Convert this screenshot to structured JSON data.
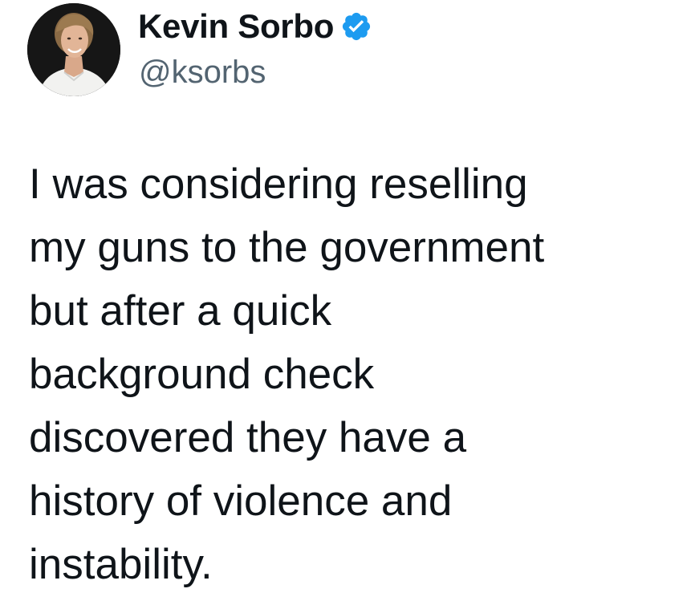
{
  "author": {
    "name": "Kevin Sorbo",
    "handle": "@ksorbs",
    "verified_icon": "verified-badge-icon",
    "verified_color": "#1d9bf0"
  },
  "tweet": {
    "lines": [
      "I was considering reselling",
      "my guns to the government",
      "but after a quick",
      "background check",
      "discovered they have a",
      "history of violence and",
      "instability."
    ]
  },
  "colors": {
    "text": "#0f1419",
    "secondary_text": "#536471",
    "background": "#ffffff"
  }
}
